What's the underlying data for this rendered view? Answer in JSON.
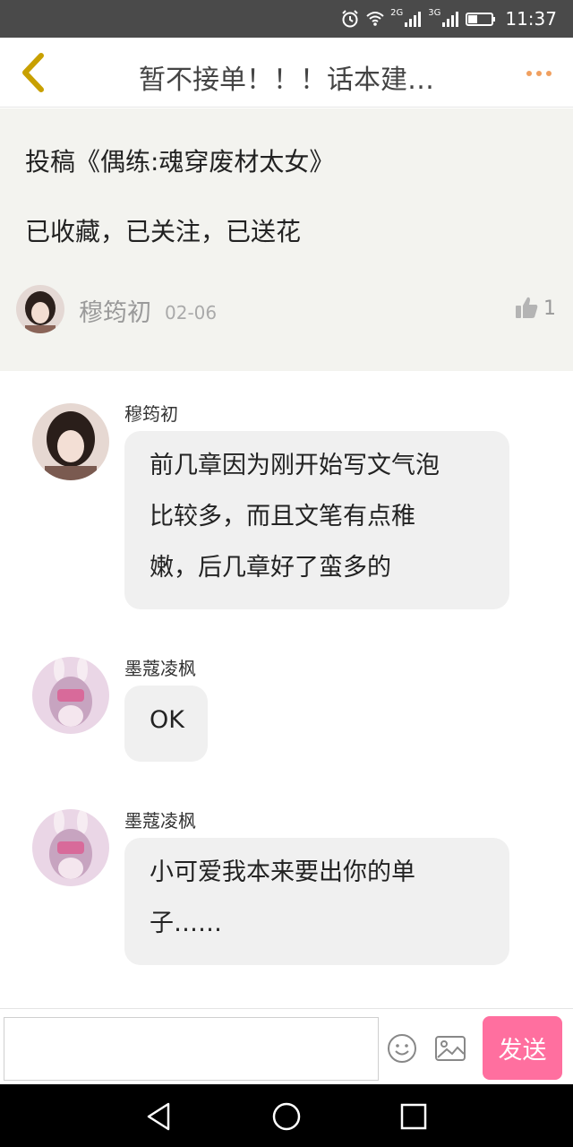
{
  "status_bar": {
    "network_1": "2G",
    "network_2": "3G",
    "time": "11:37"
  },
  "nav": {
    "title": "暂不接单！！！话本建…"
  },
  "post": {
    "line1": "投稿《偶练:魂穿废材太女》",
    "line2": "已收藏，已关注，已送花",
    "author": "穆筠初",
    "date": "02-06",
    "likes": "1"
  },
  "messages": [
    {
      "author": "穆筠初",
      "lines": [
        "前几章因为刚开始写文气泡",
        "比较多，而且文笔有点稚",
        "嫩，后几章好了蛮多的"
      ]
    },
    {
      "author": "墨蔻凌枫",
      "lines": [
        "OK"
      ]
    },
    {
      "author": "墨蔻凌枫",
      "lines": [
        "小可爱我本来要出你的单",
        "子……"
      ]
    }
  ],
  "input": {
    "placeholder": "",
    "send_label": "发送"
  },
  "icons": {
    "back": "chevron-left-icon",
    "more": "more-dots-icon",
    "like": "thumbs-up-icon",
    "emoji": "emoji-icon",
    "image": "image-icon"
  },
  "colors": {
    "accent_back": "#c8a000",
    "more_dots": "#f0a060",
    "send_button": "#ff6f9f",
    "post_background": "#f3f3ef",
    "bubble_background": "#f0f0f0"
  }
}
